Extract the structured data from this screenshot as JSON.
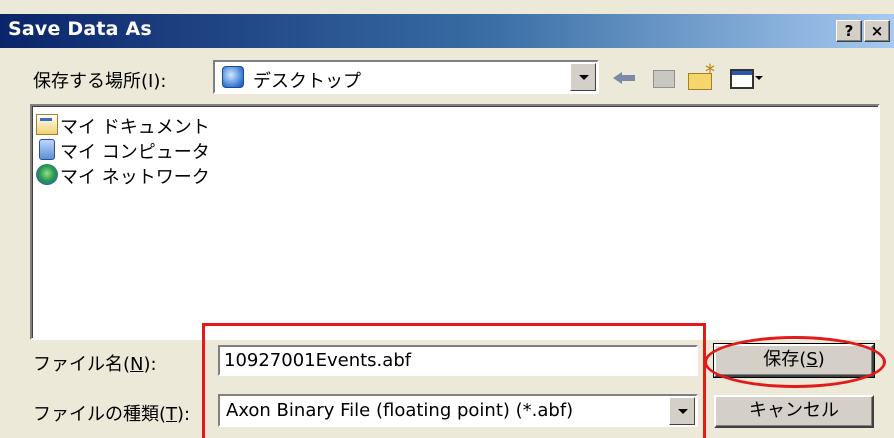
{
  "window": {
    "title": "Save Data As",
    "help_button": "?",
    "close_button": "×"
  },
  "location": {
    "label": "保存する場所(I):",
    "value": "デスクトップ"
  },
  "toolbar": {
    "icons": [
      "back-icon",
      "up-folder-icon",
      "new-folder-icon",
      "views-menu-icon"
    ]
  },
  "file_list": {
    "items": [
      {
        "label": "マイ ドキュメント",
        "icon": "my-documents-icon"
      },
      {
        "label": "マイ コンピュータ",
        "icon": "my-computer-icon"
      },
      {
        "label": "マイ ネットワーク",
        "icon": "my-network-icon"
      }
    ]
  },
  "file_name": {
    "label_prefix": "ファイル名(",
    "label_key": "N",
    "label_suffix": "):",
    "value": "10927001Events.abf"
  },
  "file_type": {
    "label_prefix": "ファイルの種類(",
    "label_key": "T",
    "label_suffix": "):",
    "value": "Axon Binary File (floating point) (*.abf)"
  },
  "buttons": {
    "save_prefix": "保存(",
    "save_key": "S",
    "save_suffix": ")",
    "cancel": "キャンセル"
  },
  "annotation_color": "#e21a1a"
}
